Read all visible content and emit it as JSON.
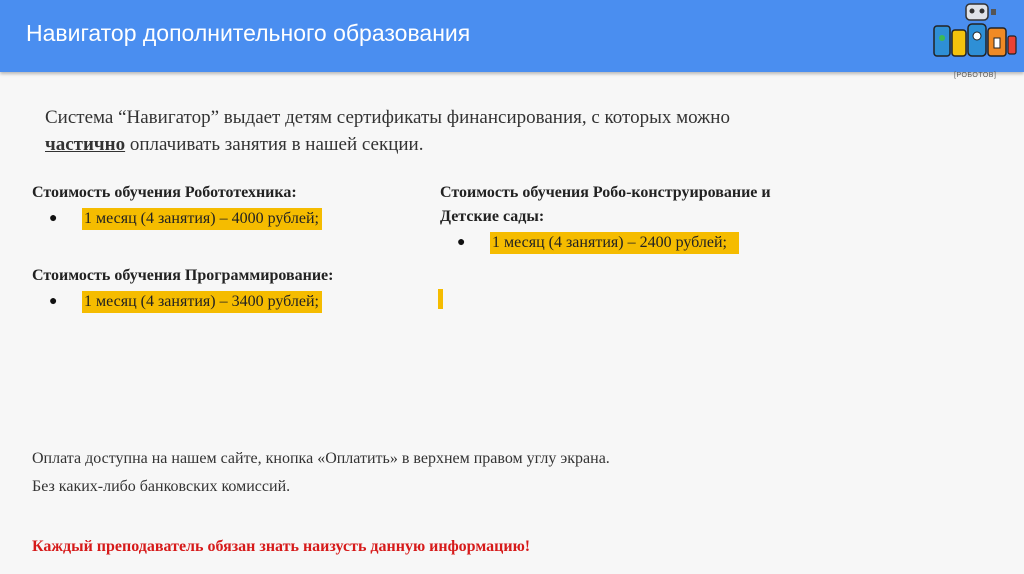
{
  "header": {
    "title": "Навигатор дополнительного образования",
    "logo_caption": "[РОБОТОВ]"
  },
  "intro": {
    "text_before": "Система “Навигатор” выдает детям сертификаты финансирования, с которых можно",
    "emphasis": "частично",
    "text_after": "оплачивать занятия в нашей секции."
  },
  "pricing": [
    {
      "title": "Стоимость обучения Робототехника:",
      "items": [
        "1 месяц (4 занятия) – 4000 рублей;"
      ]
    },
    {
      "title": "Стоимость обучения Программирование:",
      "items": [
        "1 месяц (4 занятия) – 3400 рублей;"
      ]
    },
    {
      "title_line1": "Стоимость обучения Робо-конструирование и",
      "title_line2": "Детские сады:",
      "items": [
        "1 месяц (4 занятия) – 2400 рублей;"
      ]
    }
  ],
  "bullet_symbol": "●",
  "footer": {
    "payment": "Оплата доступна на нашем сайте, кнопка «Оплатить» в верхнем правом углу экрана.",
    "no_fees": "Без каких-либо банковских комиссий.",
    "warning": "Каждый преподаватель обязан знать наизусть данную информацию!"
  },
  "colors": {
    "header": "#4a8ef0",
    "highlight": "#f5bc00",
    "warning": "#d61a1a"
  }
}
